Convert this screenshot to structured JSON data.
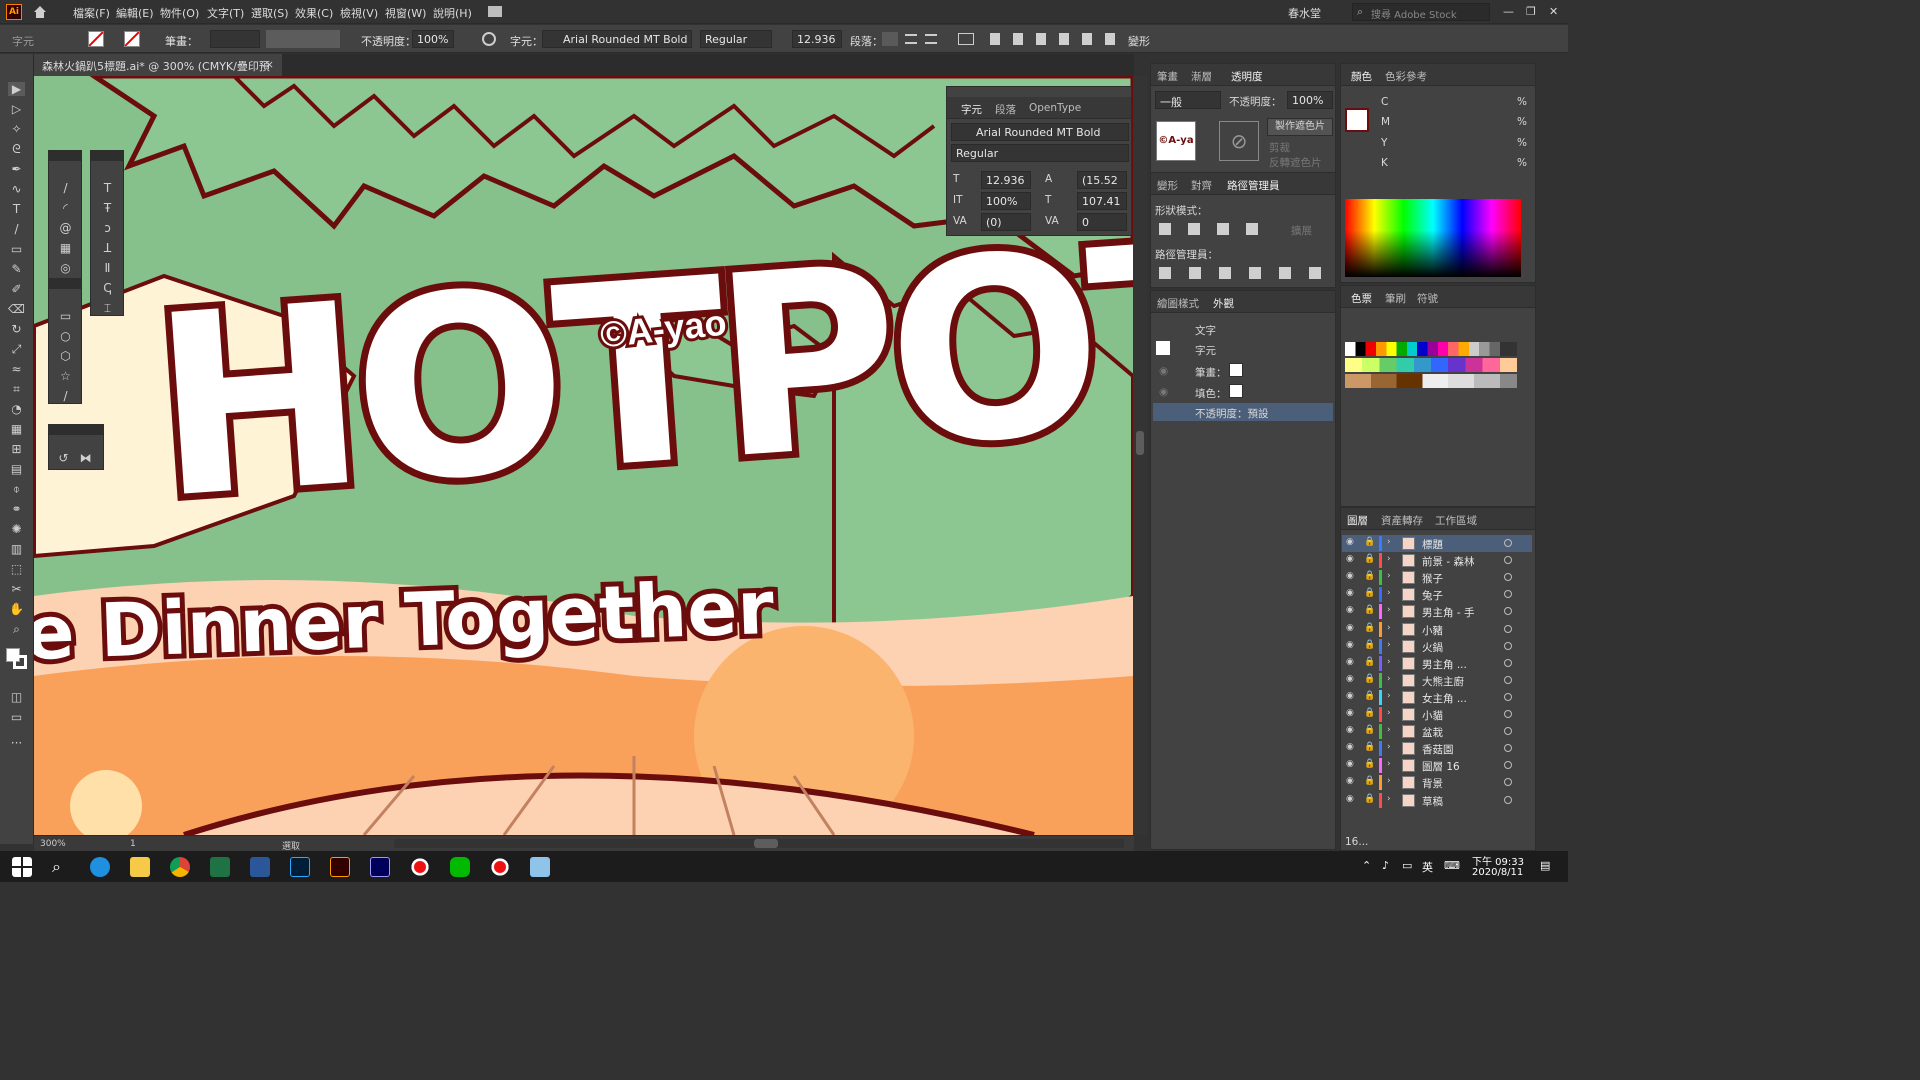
{
  "app": {
    "logo": "Ai",
    "icon": "home-icon"
  },
  "menu": [
    "檔案(F)",
    "編輯(E)",
    "物件(O)",
    "文字(T)",
    "選取(S)",
    "效果(C)",
    "檢視(V)",
    "視窗(W)",
    "說明(H)"
  ],
  "workspace": "春水堂",
  "search_placeholder": "搜尋 Adobe Stock",
  "control": {
    "mode_label": "字元",
    "stroke_label": "筆畫：",
    "opacity_label": "不透明度：",
    "opacity_value": "100%",
    "char_label": "字元：",
    "font_name": "Arial Rounded MT Bold",
    "font_style": "Regular",
    "font_size": "12.936",
    "para_label": "段落：",
    "transform_label": "變形"
  },
  "document_tab": "森林火鍋趴5標題.ai* @ 300% (CMYK/疊印預視)",
  "artwork": {
    "copyright": "©A-yao",
    "word_hotpot": "HOTPOT",
    "word_dinner": "e Dinner Together",
    "colors": {
      "bg": "#86c18c",
      "outline": "#6b0d0d",
      "orange": "#f9a15b",
      "peach": "#fcd2b3",
      "cream": "#fff3d6"
    }
  },
  "status": {
    "zoom": "300%",
    "page": "1",
    "tool": "選取"
  },
  "char_panel": {
    "tabs": [
      "字元",
      "段落",
      "OpenType"
    ],
    "font": "Arial Rounded MT Bold",
    "style": "Regular",
    "size": "12.936",
    "leading": "(15.52",
    "vscale": "100%",
    "hscale": "107.41",
    "kerning": "(0)",
    "tracking": "0"
  },
  "transparency_panel": {
    "tabs": [
      "筆畫",
      "漸層",
      "透明度"
    ],
    "blend": "一般",
    "opacity_label": "不透明度：",
    "opacity": "100%",
    "make_mask": "製作遮色片",
    "clip": "剪裁",
    "invert": "反轉遮色片",
    "thumb_text": "©A-ya"
  },
  "pathfinder_panel": {
    "tabs": [
      "變形",
      "對齊",
      "路徑管理員"
    ],
    "shape_modes": "形狀模式：",
    "expand": "擴展",
    "pathfinders": "路徑管理員："
  },
  "appearance_panel": {
    "tabs": [
      "繪圖樣式",
      "外觀"
    ],
    "title": "文字",
    "char": "字元",
    "stroke": "筆畫：",
    "fill": "填色：",
    "opacity": "不透明度：預設"
  },
  "color_panel": {
    "tabs": [
      "顏色",
      "色彩參考"
    ],
    "channels": [
      "C",
      "M",
      "Y",
      "K"
    ],
    "unit": "%"
  },
  "swatches_panel": {
    "tabs": [
      "色票",
      "筆刷",
      "符號"
    ]
  },
  "layers_panel": {
    "tabs": [
      "圖層",
      "資產轉存",
      "工作區域"
    ],
    "count": "16...",
    "layers": [
      {
        "name": "標題",
        "color": "#3b7bff"
      },
      {
        "name": "前景 - 森林",
        "color": "#ff4b4b"
      },
      {
        "name": "猴子",
        "color": "#3fbf3f"
      },
      {
        "name": "兔子",
        "color": "#3a6bff"
      },
      {
        "name": "男主角 - 手",
        "color": "#ff66ff"
      },
      {
        "name": "小豬",
        "color": "#ff9a2e"
      },
      {
        "name": "火鍋",
        "color": "#3b7bff"
      },
      {
        "name": "男主角 ...",
        "color": "#7a5cff"
      },
      {
        "name": "大熊主廚",
        "color": "#3fbf3f"
      },
      {
        "name": "女主角 ...",
        "color": "#35d6ff"
      },
      {
        "name": "小貓",
        "color": "#ff4b4b"
      },
      {
        "name": "盆栽",
        "color": "#3fbf3f"
      },
      {
        "name": "香菇園",
        "color": "#3b7bff"
      },
      {
        "name": "圖層 16",
        "color": "#ff66ff"
      },
      {
        "name": "背景",
        "color": "#ff9a2e"
      },
      {
        "name": "草稿",
        "color": "#ff4b4b"
      }
    ]
  },
  "taskbar": {
    "time": "下午 09:33",
    "date": "2020/8/11",
    "ime": "英"
  }
}
